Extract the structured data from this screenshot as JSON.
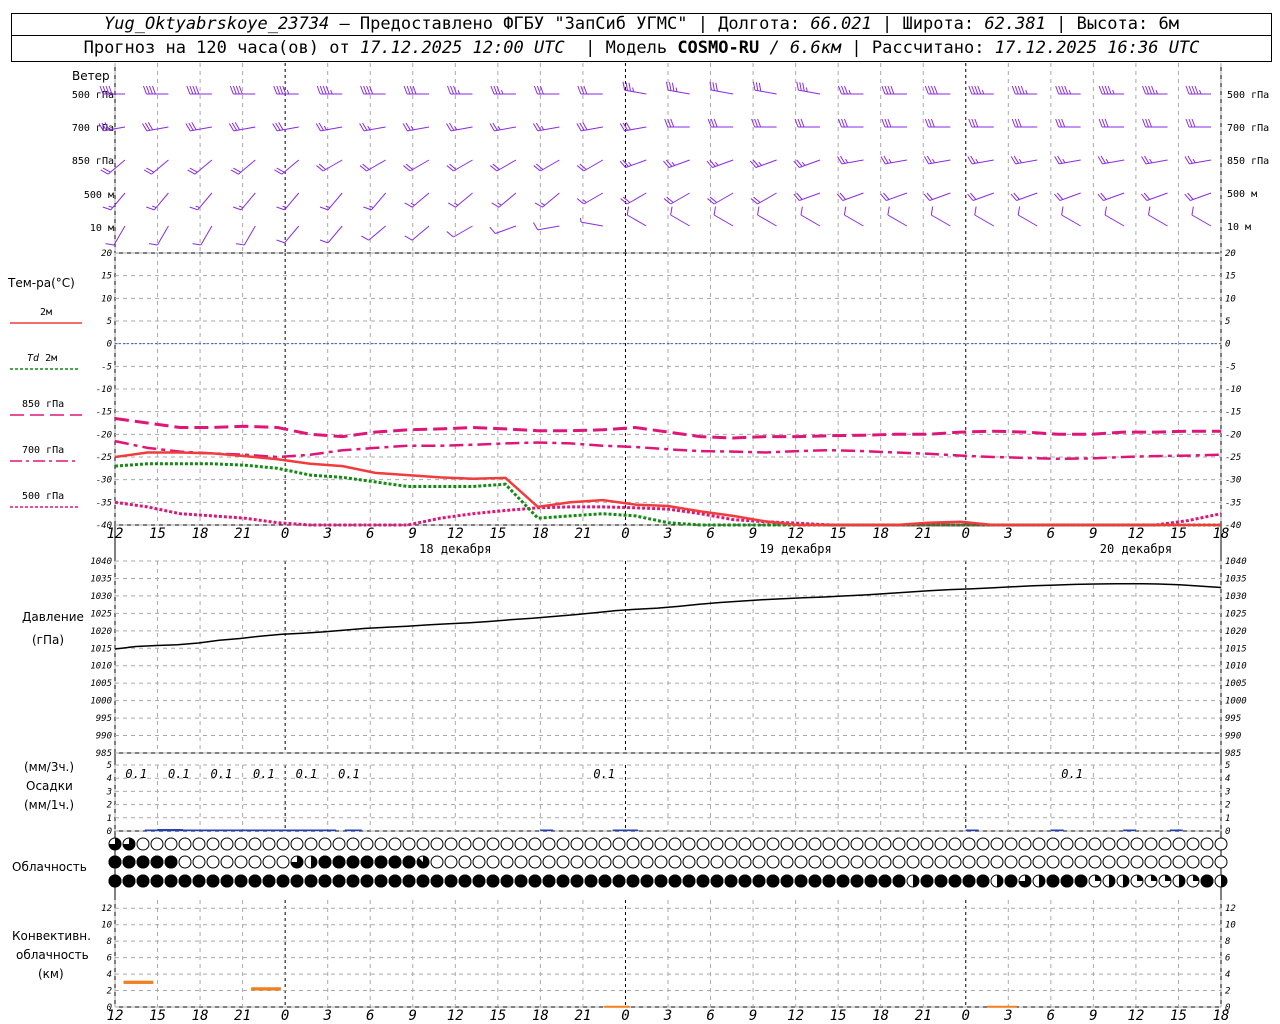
{
  "header": {
    "station": "Yug_Oktyabrskoye_23734",
    "provided_by": "– Предоставлено ФГБУ \"ЗапСиб УГМС\"",
    "lon_label": "Долгота:",
    "lon": "66.021",
    "lat_label": "Широта:",
    "lat": "62.381",
    "alt_label": "Высота:",
    "alt": "6м",
    "forecast_label": "Прогноз на 120 часа(ов) от",
    "forecast_start": "17.12.2025 12:00 UTC",
    "model_label": "Модель",
    "model": "COSMO-RU",
    "resolution": "/ 6.6км",
    "computed_label": "Рассчитано:",
    "computed": "17.12.2025 16:36 UTC"
  },
  "labels": {
    "wind": "Ветер",
    "wind_levels": [
      "500 гПа",
      "700 гПа",
      "850 гПа",
      "500 м",
      "10 м"
    ],
    "temperature": "Тем-ра(°С)",
    "t2m": "2м",
    "td": "Td",
    "td2m": "2м",
    "t850": "850 гПа",
    "t700": "700 гПа",
    "t500": "500 гПа",
    "pressure": "Давление",
    "pressure_unit": "(гПа)",
    "precip_unit_3h": "(мм/3ч.)",
    "precip": "Осадки",
    "precip_unit_1h": "(мм/1ч.)",
    "cloud": "Облачность",
    "conv1": "Конвективн.",
    "conv2": "облачность",
    "conv3": "(км)"
  },
  "colors": {
    "wind": "#8a2be2",
    "t2m": "#f03c3c",
    "td2m": "#138a13",
    "t850": "#e0157a",
    "t700": "#e0157a",
    "t500": "#e0157a",
    "zero_line": "#3a5bd8",
    "precip_bar": "#1f3fbf",
    "conv_bar": "#f08020",
    "grid": "#aaaaaa"
  },
  "chart_data": {
    "type": "line",
    "x_hour_ticks": [
      "12",
      "15",
      "18",
      "21",
      "0",
      "3",
      "6",
      "9",
      "12",
      "15",
      "18",
      "21",
      "0",
      "3",
      "6",
      "9",
      "12",
      "15",
      "18",
      "21",
      "0",
      "3",
      "6",
      "9",
      "12",
      "15",
      "18"
    ],
    "day_labels": [
      {
        "at_tick": 8,
        "text": "18 декабря"
      },
      {
        "at_tick": 16,
        "text": "19 декабря"
      },
      {
        "at_tick": 24,
        "text": "20 декабря"
      }
    ],
    "temperature": {
      "ylim": [
        -40,
        20
      ],
      "yticks": [
        20,
        15,
        10,
        5,
        0,
        -5,
        -10,
        -15,
        -20,
        -25,
        -30,
        -35,
        -40
      ],
      "t2m": [
        -25.0,
        -24.0,
        -24.0,
        -24.2,
        -24.8,
        -25.5,
        -26.5,
        -27.0,
        -28.5,
        -29.0,
        -29.5,
        -29.8,
        -29.6,
        -36.0,
        -35.0,
        -34.5,
        -35.5,
        -35.8,
        -37.0,
        -38.0,
        -39.2,
        -40.0,
        -40.0,
        -40.2,
        -40.5,
        -39.5,
        -39.3,
        -40.0,
        -40.5,
        -40.5,
        -41.0,
        -41.5,
        -41.8,
        -42.5,
        -42.0
      ],
      "td2m": [
        -27.0,
        -26.5,
        -26.5,
        -26.5,
        -26.8,
        -27.5,
        -29.0,
        -29.5,
        -30.5,
        -31.5,
        -31.5,
        -31.5,
        -31.0,
        -38.5,
        -38.0,
        -37.5,
        -38.0,
        -39.5,
        -40.0,
        -41.0,
        -41.5,
        -42.0,
        -42.5,
        -42.5,
        -43.0,
        -42.8,
        -42.8,
        -43.0,
        -43.2,
        -43.5,
        -43.8,
        -44.0,
        -44.0,
        -44.2,
        -44.5
      ],
      "t850": [
        -16.5,
        -17.5,
        -18.5,
        -18.5,
        -18.2,
        -18.5,
        -20.0,
        -20.5,
        -19.5,
        -19.0,
        -18.8,
        -18.5,
        -18.8,
        -19.2,
        -19.2,
        -19.0,
        -18.5,
        -19.5,
        -20.5,
        -20.8,
        -20.5,
        -20.5,
        -20.3,
        -20.2,
        -20.0,
        -20.0,
        -19.5,
        -19.3,
        -19.5,
        -20.0,
        -20.0,
        -19.5,
        -19.5,
        -19.3,
        -19.3
      ],
      "t700": [
        -21.5,
        -23.0,
        -23.8,
        -24.2,
        -24.5,
        -25.0,
        -24.5,
        -23.5,
        -23.0,
        -22.5,
        -22.5,
        -22.3,
        -22.0,
        -21.8,
        -22.0,
        -22.5,
        -22.8,
        -23.3,
        -23.7,
        -23.8,
        -24.0,
        -23.7,
        -23.5,
        -23.7,
        -24.0,
        -24.3,
        -24.7,
        -25.0,
        -25.2,
        -25.4,
        -25.3,
        -25.0,
        -24.8,
        -24.7,
        -24.5
      ],
      "t500": [
        -35.0,
        -36.0,
        -37.5,
        -38.0,
        -38.5,
        -39.5,
        -40.5,
        -42.0,
        -41.0,
        -40.0,
        -38.5,
        -37.5,
        -36.8,
        -36.2,
        -36.0,
        -36.0,
        -36.2,
        -36.5,
        -37.5,
        -38.8,
        -39.3,
        -39.6,
        -40.0,
        -40.5,
        -41.0,
        -41.5,
        -42.0,
        -42.2,
        -42.0,
        -41.5,
        -41.0,
        -40.5,
        -40.0,
        -39.0,
        -37.5
      ]
    },
    "pressure": {
      "ylim": [
        985,
        1040
      ],
      "yticks": [
        1040,
        1035,
        1030,
        1025,
        1020,
        1015,
        1010,
        1005,
        1000,
        995,
        990,
        985
      ],
      "values": [
        1014.8,
        1015.5,
        1015.8,
        1016.0,
        1016.5,
        1017.3,
        1017.8,
        1018.5,
        1019.0,
        1019.3,
        1019.7,
        1020.2,
        1020.7,
        1021.0,
        1021.3,
        1021.7,
        1022.0,
        1022.3,
        1022.7,
        1023.2,
        1023.6,
        1024.1,
        1024.6,
        1025.2,
        1025.8,
        1026.2,
        1026.5,
        1027.0,
        1027.6,
        1028.1,
        1028.5,
        1028.9,
        1029.2,
        1029.5,
        1029.7,
        1030.0,
        1030.3,
        1030.7,
        1031.1,
        1031.5,
        1031.8,
        1032.0,
        1032.3,
        1032.6,
        1032.9,
        1033.1,
        1033.3,
        1033.4,
        1033.5,
        1033.5,
        1033.4,
        1033.2,
        1032.8,
        1032.4
      ]
    },
    "precip": {
      "ylim": [
        0,
        5
      ],
      "yticks": [
        5,
        4,
        3,
        2,
        1,
        0
      ],
      "totals_3h": [
        {
          "at_tick": 0.5,
          "text": "0.1"
        },
        {
          "at_tick": 1.5,
          "text": "0.1"
        },
        {
          "at_tick": 2.5,
          "text": "0.1"
        },
        {
          "at_tick": 3.5,
          "text": "0.1"
        },
        {
          "at_tick": 4.5,
          "text": "0.1"
        },
        {
          "at_tick": 5.5,
          "text": "0.1"
        },
        {
          "at_tick": 11.5,
          "text": "0.1"
        },
        {
          "at_tick": 22.5,
          "text": "0.1"
        }
      ],
      "bars_1h": [
        {
          "start": 0.7,
          "end": 1.0,
          "value": 0.05
        },
        {
          "start": 1.0,
          "end": 1.6,
          "value": 0.15
        },
        {
          "start": 1.6,
          "end": 5.2,
          "value": 0.05
        },
        {
          "start": 5.4,
          "end": 5.8,
          "value": 0.05
        },
        {
          "start": 10.0,
          "end": 10.3,
          "value": 0.05
        },
        {
          "start": 11.7,
          "end": 12.0,
          "value": 0.05
        },
        {
          "start": 12.0,
          "end": 12.3,
          "value": 0.05
        },
        {
          "start": 20.0,
          "end": 20.3,
          "value": 0.05
        },
        {
          "start": 22.0,
          "end": 22.3,
          "value": 0.05
        },
        {
          "start": 23.7,
          "end": 24.0,
          "value": 0.05
        },
        {
          "start": 24.8,
          "end": 25.1,
          "value": 0.05
        }
      ]
    },
    "cloud_cover_eighths": {
      "high": [
        6,
        6,
        0,
        0,
        0,
        0,
        0,
        0,
        0,
        0,
        0,
        0,
        0,
        0,
        0,
        0,
        0,
        0,
        0,
        0,
        0,
        0,
        0,
        0,
        0,
        0,
        0,
        0,
        0,
        0,
        0,
        0,
        0,
        0,
        0,
        0,
        0,
        0,
        0,
        0,
        0,
        0,
        0,
        0,
        0,
        0,
        0,
        0,
        0,
        0,
        0,
        0,
        0,
        0,
        0,
        0,
        0,
        0,
        0,
        0,
        0,
        0,
        0,
        0,
        0,
        0,
        0,
        0,
        0,
        0,
        0,
        0,
        0,
        0,
        0,
        0,
        0,
        0,
        0,
        0
      ],
      "middle": [
        8,
        8,
        8,
        8,
        8,
        0,
        0,
        0,
        0,
        0,
        0,
        0,
        0,
        6,
        4,
        8,
        8,
        8,
        8,
        8,
        8,
        8,
        7,
        0,
        0,
        0,
        0,
        0,
        0,
        0,
        0,
        0,
        0,
        0,
        0,
        0,
        0,
        0,
        0,
        0,
        0,
        0,
        0,
        0,
        0,
        0,
        0,
        0,
        0,
        0,
        0,
        0,
        0,
        0,
        0,
        0,
        0,
        0,
        0,
        0,
        0,
        0,
        0,
        0,
        0,
        0,
        0,
        0,
        0,
        0,
        0,
        0,
        0,
        0,
        0,
        0,
        0,
        0,
        0,
        0
      ],
      "low": [
        8,
        8,
        8,
        8,
        8,
        8,
        8,
        8,
        8,
        8,
        8,
        8,
        8,
        8,
        8,
        8,
        8,
        8,
        8,
        8,
        8,
        8,
        8,
        8,
        8,
        8,
        8,
        8,
        8,
        8,
        8,
        8,
        8,
        8,
        8,
        8,
        8,
        8,
        8,
        8,
        8,
        8,
        8,
        8,
        8,
        8,
        8,
        8,
        8,
        8,
        8,
        8,
        8,
        8,
        8,
        8,
        8,
        4,
        8,
        8,
        8,
        8,
        8,
        4,
        8,
        6,
        4,
        8,
        8,
        8,
        2,
        4,
        4,
        2,
        2,
        2,
        4,
        2,
        8,
        4,
        8,
        8,
        8,
        8,
        8,
        8,
        8,
        8,
        8,
        8,
        8,
        8,
        8,
        8,
        8,
        8,
        8,
        8,
        8,
        8,
        8,
        8,
        8,
        8,
        8,
        8,
        8,
        8,
        8,
        8
      ]
    },
    "convective": {
      "ylim": [
        0,
        13
      ],
      "yticks": [
        12,
        10,
        8,
        6,
        4,
        2,
        0
      ],
      "segments": [
        {
          "start": 0.2,
          "end": 0.9,
          "base": 2.8,
          "top": 3.2
        },
        {
          "start": 3.2,
          "end": 3.9,
          "base": 2.0,
          "top": 2.4
        },
        {
          "start": 11.5,
          "end": 12.1,
          "base": 0.0,
          "top": 0.15
        },
        {
          "start": 20.5,
          "end": 21.2,
          "base": 0.0,
          "top": 0.15
        }
      ]
    },
    "wind_barbs": {
      "levels": [
        "500 гПа",
        "700 гПа",
        "850 гПа",
        "500 м",
        "10 м"
      ],
      "speed_knots": [
        [
          40,
          40,
          40,
          40,
          45,
          45,
          40,
          40,
          35,
          35,
          30,
          30,
          35,
          35,
          30,
          30,
          35,
          35,
          40,
          40,
          45,
          45,
          45,
          45,
          45,
          45
        ],
        [
          30,
          30,
          30,
          30,
          30,
          25,
          25,
          25,
          25,
          25,
          25,
          30,
          30,
          30,
          30,
          30,
          30,
          30,
          30,
          30,
          30,
          30,
          30,
          30,
          30,
          30
        ],
        [
          20,
          20,
          20,
          20,
          20,
          20,
          20,
          20,
          20,
          20,
          20,
          20,
          25,
          25,
          25,
          25,
          25,
          25,
          25,
          25,
          25,
          25,
          25,
          25,
          25,
          25
        ],
        [
          15,
          15,
          15,
          15,
          15,
          15,
          15,
          15,
          15,
          15,
          15,
          15,
          20,
          20,
          20,
          20,
          20,
          20,
          20,
          20,
          20,
          20,
          20,
          20,
          20,
          20
        ],
        [
          10,
          10,
          10,
          10,
          10,
          10,
          10,
          10,
          10,
          10,
          10,
          5,
          10,
          10,
          10,
          10,
          10,
          10,
          10,
          10,
          10,
          10,
          10,
          10,
          10,
          10
        ]
      ],
      "direction_deg": [
        [
          270,
          270,
          270,
          270,
          270,
          270,
          270,
          270,
          270,
          270,
          270,
          270,
          280,
          280,
          280,
          280,
          280,
          270,
          270,
          270,
          270,
          270,
          270,
          270,
          270,
          270
        ],
        [
          260,
          260,
          260,
          260,
          260,
          260,
          260,
          260,
          260,
          260,
          260,
          260,
          260,
          270,
          270,
          270,
          270,
          270,
          270,
          270,
          270,
          270,
          270,
          270,
          270,
          270
        ],
        [
          230,
          230,
          230,
          230,
          230,
          240,
          240,
          240,
          240,
          240,
          240,
          240,
          250,
          250,
          250,
          250,
          250,
          260,
          260,
          260,
          260,
          260,
          260,
          260,
          260,
          260
        ],
        [
          220,
          220,
          220,
          220,
          220,
          220,
          220,
          230,
          230,
          230,
          230,
          240,
          240,
          240,
          240,
          240,
          250,
          250,
          250,
          250,
          250,
          250,
          250,
          250,
          250,
          250
        ],
        [
          210,
          210,
          210,
          210,
          220,
          220,
          230,
          230,
          240,
          250,
          260,
          280,
          300,
          300,
          300,
          300,
          300,
          300,
          300,
          300,
          300,
          300,
          300,
          300,
          300,
          300
        ]
      ]
    }
  }
}
